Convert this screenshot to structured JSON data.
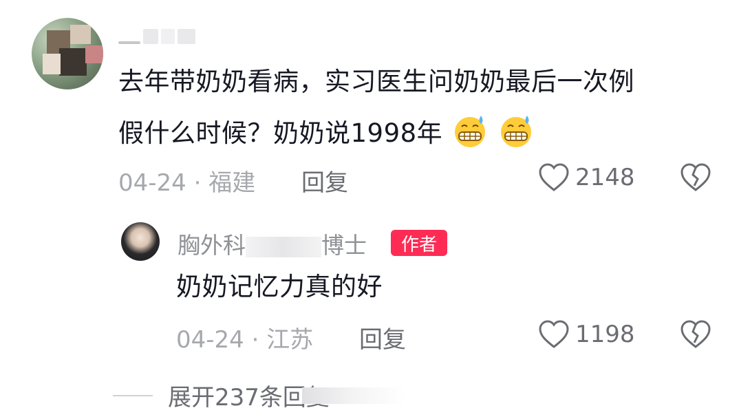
{
  "comment": {
    "text_line1": "去年带奶奶看病，实习医生问奶奶最后一次例",
    "text_line2": "假什么时候？奶奶说1998年",
    "emoji": [
      "grimacing-sweat-emoji",
      "grimacing-sweat-emoji"
    ],
    "date_location": "04-24 · 福建",
    "reply_label": "回复",
    "like_count": "2148",
    "icons": {
      "like": "heart-outline-icon",
      "dislike": "broken-heart-icon"
    }
  },
  "reply": {
    "username_prefix": "胸外科",
    "username_suffix": "博士",
    "author_badge": "作者",
    "text": "奶奶记忆力真的好",
    "date_location": "04-24 · 江苏",
    "reply_label": "回复",
    "like_count": "1198"
  },
  "expand": {
    "label": "展开237条回复"
  },
  "colors": {
    "accent": "#fe2c55",
    "text_primary": "#161823",
    "text_secondary": "#a6a8ad"
  }
}
